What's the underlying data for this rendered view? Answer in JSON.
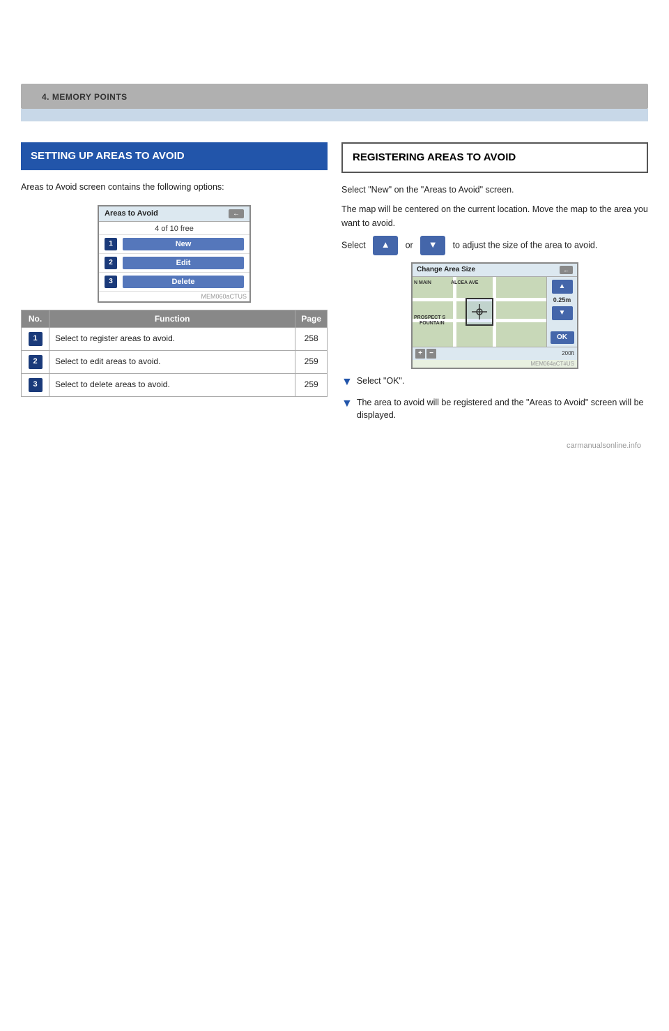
{
  "page": {
    "header": "4. MEMORY POINTS"
  },
  "left_section": {
    "title": "SETTING UP AREAS TO AVOID",
    "body1": "Areas to Avoid screen contains the following options:",
    "screen": {
      "title": "Areas to Avoid",
      "subtitle": "4 of 10 free",
      "back_label": "←",
      "items": [
        {
          "num": "1",
          "label": "New"
        },
        {
          "num": "2",
          "label": "Edit"
        },
        {
          "num": "3",
          "label": "Delete"
        }
      ],
      "footer": "MEM060aCTUS"
    },
    "table": {
      "col_no": "No.",
      "col_function": "Function",
      "col_page": "Page",
      "rows": [
        {
          "num": "1",
          "function": "Select to register areas to avoid.",
          "page": "258"
        },
        {
          "num": "2",
          "function": "Select to edit areas to avoid.",
          "page": "259"
        },
        {
          "num": "3",
          "function": "Select to delete areas to avoid.",
          "page": "259"
        }
      ]
    }
  },
  "right_section": {
    "title": "REGISTERING AREAS TO AVOID",
    "body1": "Select \"New\" on the \"Areas to Avoid\" screen.",
    "body2": "The map will be centered on the current location. Move the map to the area you want to avoid.",
    "body3": "Select",
    "body4": "or",
    "body5": "to adjust the size of the area to avoid.",
    "up_btn": "▲",
    "down_btn": "▼",
    "map_screen": {
      "title": "Change Area Size",
      "back_label": "←",
      "size_label": "0.25m",
      "ok_label": "OK",
      "scale_label": "200ft",
      "footer": "MEM064aCT#US"
    },
    "bullet1": "Select \"OK\".",
    "bullet2": "The area to avoid will be registered and the \"Areas to Avoid\" screen will be displayed."
  }
}
